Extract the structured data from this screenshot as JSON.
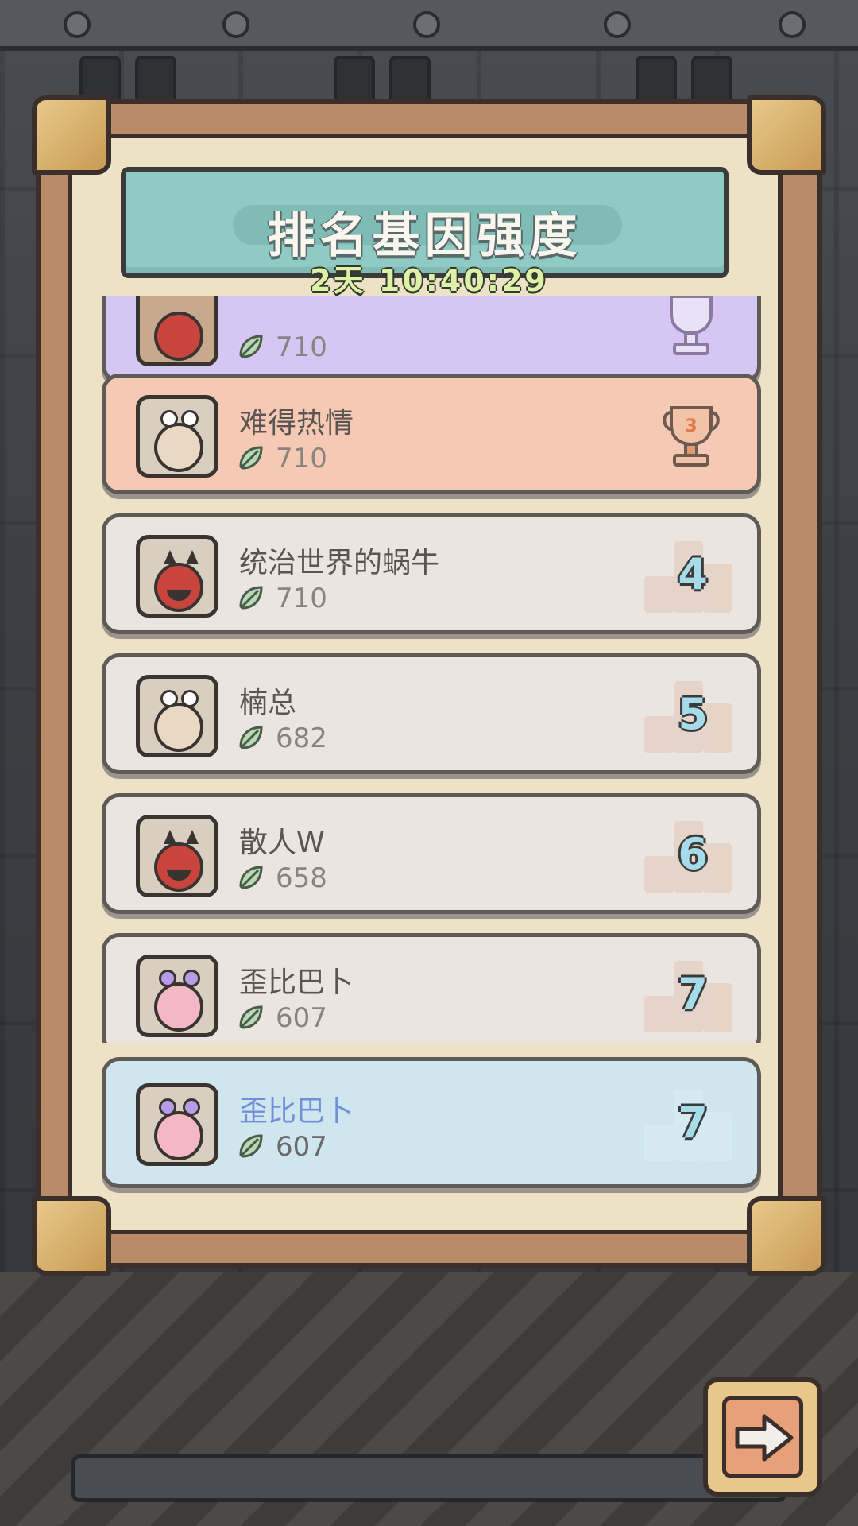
{
  "title": "排名基因强度",
  "countdown": "2天 10:40:29",
  "rows": [
    {
      "name": "",
      "score": "710",
      "rank": "2",
      "variant": "purple"
    },
    {
      "name": "难得热情",
      "score": "710",
      "rank": "3",
      "variant": "orange"
    },
    {
      "name": "统治世界的蜗牛",
      "score": "710",
      "rank": "4",
      "variant": "gray"
    },
    {
      "name": "楠总",
      "score": "682",
      "rank": "5",
      "variant": "gray"
    },
    {
      "name": "散人W",
      "score": "658",
      "rank": "6",
      "variant": "gray"
    },
    {
      "name": "歪比巴卜",
      "score": "607",
      "rank": "7",
      "variant": "gray"
    }
  ],
  "self_row": {
    "name": "歪比巴卜",
    "score": "607",
    "rank": "7"
  },
  "colors": {
    "banner": "#8fcbc4",
    "rank_silver": "#d6c6f4",
    "rank_bronze": "#f6c9b4",
    "row_default": "#ebe5e2",
    "self_row": "#cfe6ee",
    "self_name": "#6f8fd8"
  },
  "icons": {
    "score": "leaf-gene-icon",
    "next": "arrow-right-icon"
  }
}
